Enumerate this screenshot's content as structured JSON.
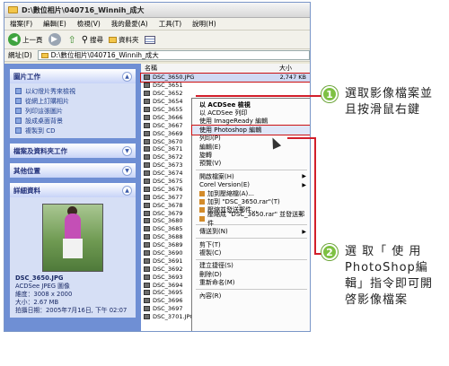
{
  "window": {
    "title": "D:\\數位相片\\040716_Winnih_成大"
  },
  "menubar": [
    "檔案(F)",
    "編輯(E)",
    "檢視(V)",
    "我的最愛(A)",
    "工具(T)",
    "說明(H)"
  ],
  "toolbar": {
    "back": "上一頁",
    "search": "搜尋",
    "folders": "資料夾"
  },
  "address": {
    "label": "網址(D)",
    "value": "D:\\數位相片\\040716_Winnih_成大"
  },
  "left_pane": {
    "picture_tasks": {
      "title": "圖片工作",
      "items": [
        "以幻燈片秀來檢視",
        "從網上訂購相片",
        "列印這張圖片",
        "設成桌面背景",
        "複製到 CD"
      ]
    },
    "file_tasks": {
      "title": "檔案及資料夾工作"
    },
    "other_places": {
      "title": "其他位置"
    },
    "details": {
      "title": "詳細資料",
      "filename": "DSC_3650.JPG",
      "filetype": "ACDSee JPEG 圖像",
      "dimensions": "維度：3008 x 2000",
      "size": "大小：2.67 MB",
      "date": "拍攝日期：2005年7月16日, 下午 02:07"
    }
  },
  "file_list": {
    "columns": [
      "名稱",
      "大小"
    ],
    "files": [
      "DSC_3650.JPG",
      "DSC_3651",
      "DSC_3652",
      "DSC_3654",
      "DSC_3655",
      "DSC_3666",
      "DSC_3667",
      "DSC_3669",
      "DSC_3670",
      "DSC_3671",
      "DSC_3672",
      "DSC_3673",
      "DSC_3674",
      "DSC_3675",
      "DSC_3676",
      "DSC_3677",
      "DSC_3678",
      "DSC_3679",
      "DSC_3680",
      "DSC_3685",
      "DSC_3688",
      "DSC_3689",
      "DSC_3690",
      "DSC_3691",
      "DSC_3692",
      "DSC_3693",
      "DSC_3694",
      "DSC_3695",
      "DSC_3696",
      "DSC_3697",
      "DSC_3701.JPG"
    ],
    "first_size": "2,747 KB",
    "last_size": "2,106 KB",
    "last_type": "ACDS"
  },
  "context_menu": {
    "items": [
      "以 ACDSee 檢視",
      "以 ACDSee 列印",
      "使用 ImageReady 編輯",
      "使用 Photoshop 編輯",
      "列印(P)",
      "編輯(E)",
      "旋轉",
      "預覽(V)",
      "開啟檔案(H)",
      "Corel Version(E)",
      "加到壓縮檔(A)...",
      "加到 \"DSC_3650.rar\"(T)",
      "壓縮並發送郵件...",
      "壓縮成 \"DSC_3650.rar\" 並發送郵件",
      "傳送到(N)",
      "剪下(T)",
      "複製(C)",
      "建立捷徑(S)",
      "刪除(D)",
      "重新命名(M)",
      "內容(R)"
    ]
  },
  "callouts": [
    {
      "number": "1",
      "text_line1": "選取影像檔案並",
      "text_line2": "且按滑鼠右鍵"
    },
    {
      "number": "2",
      "text_line1": "選 取「 使 用",
      "text_line2": "PhotoShop編",
      "text_line3": "輯」指令即可開",
      "text_line4": "啓影像檔案"
    }
  ],
  "colors": {
    "accent_red": "#d21f2b",
    "badge_green": "#7ec143",
    "xp_blue": "#6f8fd4"
  }
}
